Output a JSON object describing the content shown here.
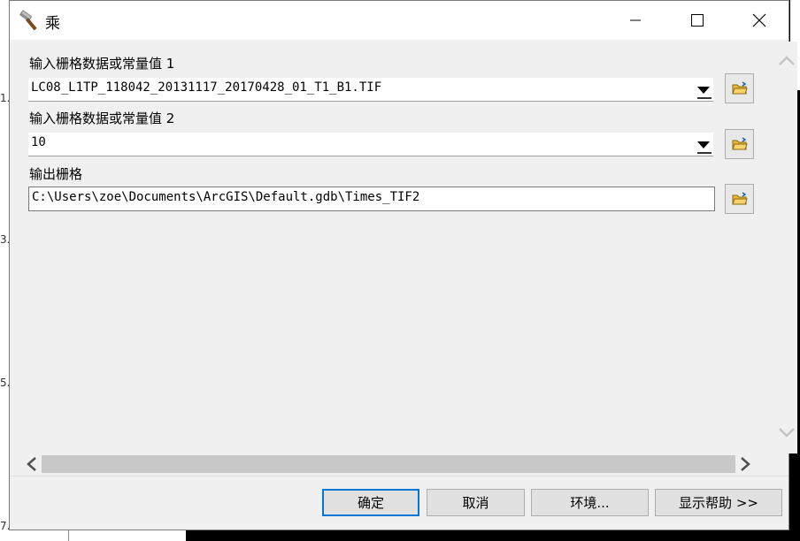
{
  "window": {
    "title": "乘",
    "title_icon": "hammer-icon",
    "controls": [
      "minimize-icon",
      "maximize-icon",
      "close-icon"
    ]
  },
  "background": {
    "ticks": [
      "1.",
      "3.",
      "5.",
      "7."
    ]
  },
  "form": {
    "input1": {
      "label": "输入栅格数据或常量值 1",
      "value": "LC08_L1TP_118042_20131117_20170428_01_T1_B1.TIF"
    },
    "input2": {
      "label": "输入栅格数据或常量值 2",
      "value": "10"
    },
    "output": {
      "label": "输出栅格",
      "value": "C:\\Users\\zoe\\Documents\\ArcGIS\\Default.gdb\\Times_TIF2"
    }
  },
  "buttons": {
    "ok": "确定",
    "cancel": "取消",
    "environments": "环境...",
    "show_help": "显示帮助 >>"
  },
  "colors": {
    "dialog_bg": "#f0f0f0",
    "accent": "#0078d7",
    "folder": "#e8b83a"
  }
}
